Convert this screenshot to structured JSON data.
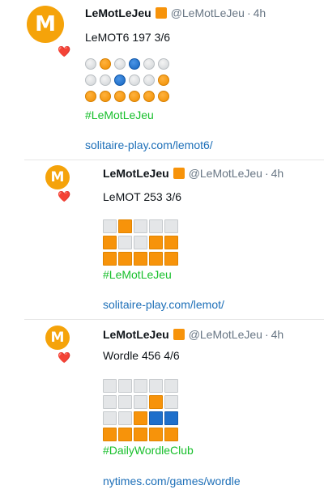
{
  "posts": [
    {
      "name": "LeMotLeJeu",
      "avatar_letter": "M",
      "heart": "❤️",
      "handle": "@LeMotLeJeu",
      "separator": "·",
      "time": "4h",
      "text": "LeMOT6 197 3/6",
      "grid_style": "circle",
      "grid": [
        [
          "gray",
          "orange",
          "gray",
          "blue",
          "gray",
          "gray"
        ],
        [
          "gray",
          "gray",
          "blue",
          "gray",
          "gray",
          "orange"
        ],
        [
          "orange",
          "orange",
          "orange",
          "orange",
          "orange",
          "orange"
        ]
      ],
      "hashtag": "#LeMotLeJeu",
      "link": "solitaire-play.com/lemot6/"
    },
    {
      "name": "LeMotLeJeu",
      "avatar_letter": "M",
      "heart": "❤️",
      "handle": "@LeMotLeJeu",
      "separator": "·",
      "time": "4h",
      "text": "LeMOT 253 3/6",
      "grid_style": "square",
      "grid": [
        [
          "gray",
          "orange",
          "gray",
          "gray",
          "gray"
        ],
        [
          "orange",
          "gray",
          "gray",
          "orange",
          "orange"
        ],
        [
          "orange",
          "orange",
          "orange",
          "orange",
          "orange"
        ]
      ],
      "hashtag": "#LeMotLeJeu",
      "link": "solitaire-play.com/lemot/"
    },
    {
      "name": "LeMotLeJeu",
      "avatar_letter": "M",
      "heart": "❤️",
      "handle": "@LeMotLeJeu",
      "separator": "·",
      "time": "4h",
      "text": "Wordle 456 4/6",
      "grid_style": "square",
      "grid": [
        [
          "gray",
          "gray",
          "gray",
          "gray",
          "gray"
        ],
        [
          "gray",
          "gray",
          "gray",
          "orange",
          "gray"
        ],
        [
          "gray",
          "gray",
          "orange",
          "blue",
          "blue"
        ],
        [
          "orange",
          "orange",
          "orange",
          "orange",
          "orange"
        ]
      ],
      "hashtag": "#DailyWordleClub",
      "link": "nytimes.com/games/wordle"
    }
  ],
  "colors": {
    "gray": "#e4e6e8",
    "orange": "#f7930a",
    "blue": "#1e6fcb",
    "hashtag": "#17bf2b",
    "link": "#1d6fb8"
  },
  "icons": {
    "avatar": "orange-circle-avatar",
    "badge": "orange-square-badge",
    "heart": "red-heart-icon"
  }
}
